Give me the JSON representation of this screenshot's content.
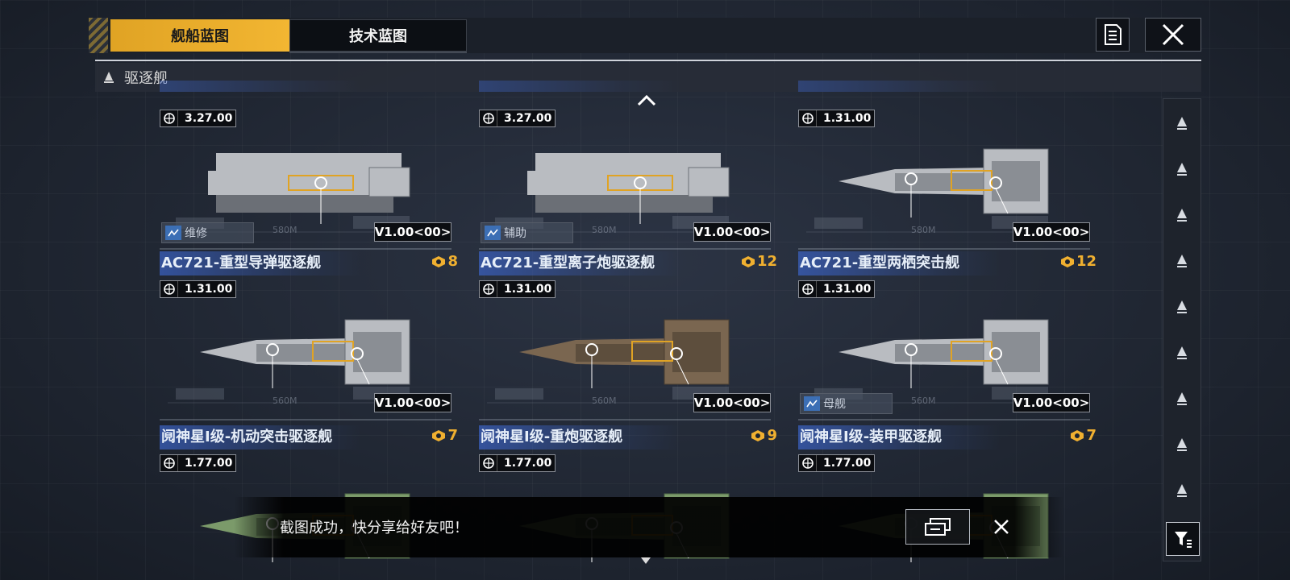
{
  "tabs": {
    "ship_blueprint": "舰船蓝图",
    "tech_blueprint": "技术蓝图"
  },
  "filter": {
    "label": "驱逐舰"
  },
  "cards": [
    {
      "title": "",
      "cost": "",
      "stat": "3.27.00",
      "version": "V1.00<00>",
      "tag": "维修",
      "scale": "580M"
    },
    {
      "title": "",
      "cost": "",
      "stat": "3.27.00",
      "version": "V1.00<00>",
      "tag": "辅助",
      "scale": "580M"
    },
    {
      "title": "",
      "cost": "",
      "stat": "1.31.00",
      "version": "V1.00<00>",
      "tag": "",
      "scale": "580M"
    },
    {
      "title": "AC721-重型导弹驱逐舰",
      "cost": "8",
      "stat": "1.31.00",
      "version": "V1.00<00>",
      "tag": "",
      "scale": "560M"
    },
    {
      "title": "AC721-重型离子炮驱逐舰",
      "cost": "12",
      "stat": "1.31.00",
      "version": "V1.00<00>",
      "tag": "",
      "scale": "560M"
    },
    {
      "title": "AC721-重型两栖突击舰",
      "cost": "12",
      "stat": "1.31.00",
      "version": "V1.00<00>",
      "tag": "母舰",
      "scale": "560M"
    },
    {
      "title": "阋神星I级-机动突击驱逐舰",
      "cost": "7",
      "stat": "1.77.00",
      "version": "",
      "tag": "",
      "scale": ""
    },
    {
      "title": "阋神星I级-重炮驱逐舰",
      "cost": "9",
      "stat": "1.77.00",
      "version": "",
      "tag": "",
      "scale": ""
    },
    {
      "title": "阋神星I级-装甲驱逐舰",
      "cost": "7",
      "stat": "1.77.00",
      "version": "",
      "tag": "",
      "scale": ""
    }
  ],
  "rail": {
    "icons": [
      "cruiser-class-icon",
      "frigate-class-icon",
      "carrier-class-icon",
      "corvette-class-icon",
      "destroyer-class-icon",
      "fighter-class-icon",
      "battleship-class-icon",
      "squadron-icon",
      "auxiliary-class-icon"
    ]
  },
  "toast": {
    "message": "截图成功，快分享给好友吧！"
  },
  "colors": {
    "accent": "#f2b632",
    "title_band": "#3a60be",
    "cost": "#f0b030"
  }
}
